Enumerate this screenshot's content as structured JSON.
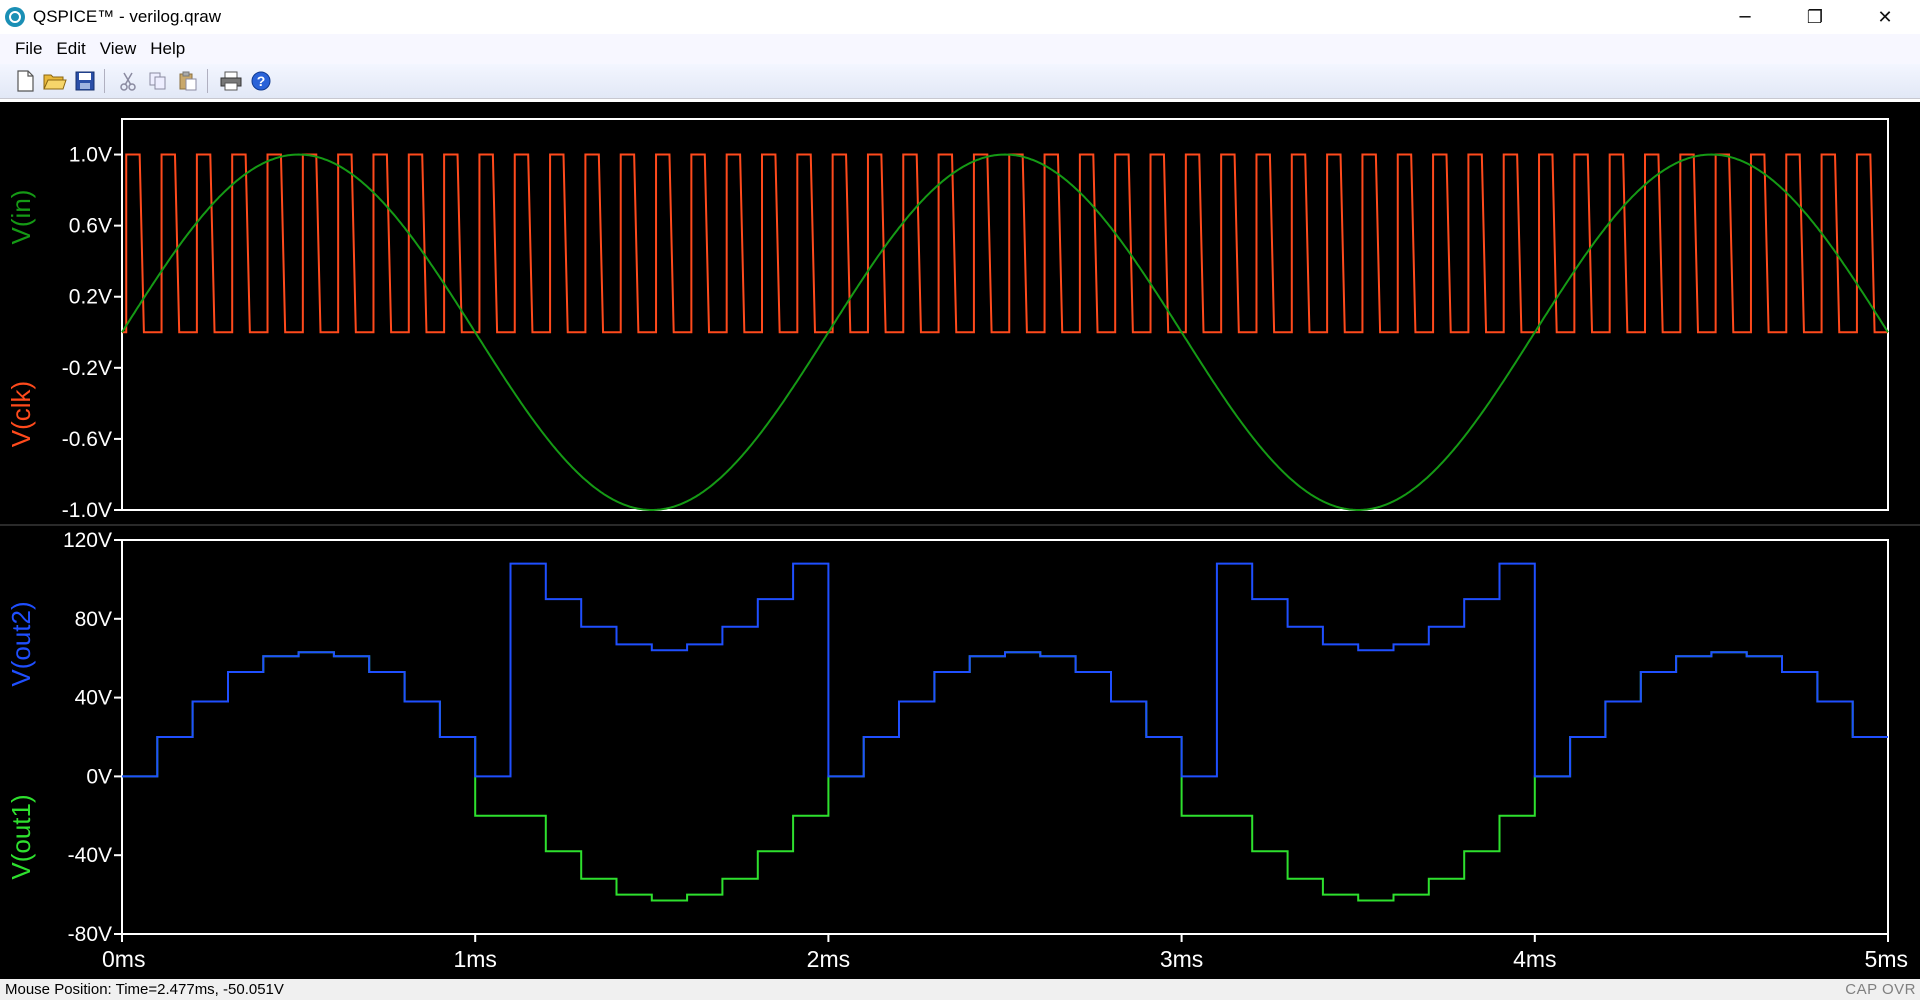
{
  "window": {
    "title": "QSPICE™ - verilog.qraw",
    "minimize_glyph": "─",
    "restore_glyph": "❐",
    "close_glyph": "✕"
  },
  "menu": {
    "items": [
      "File",
      "Edit",
      "View",
      "Help"
    ]
  },
  "toolbar": {
    "buttons": [
      "new-file-icon",
      "open-folder-icon",
      "save-icon",
      "cut-icon",
      "copy-icon",
      "paste-icon",
      "print-icon",
      "help-icon"
    ]
  },
  "colors": {
    "clk": "#ff4a1c",
    "in": "#159a15",
    "out1": "#2ee02e",
    "out2": "#1f4fff",
    "axis": "#ffffff",
    "background": "#000000"
  },
  "chart_data": [
    {
      "type": "line",
      "series": [
        {
          "name": "V(in)",
          "waveform": "sine",
          "amplitude": 1.0,
          "frequency_hz": 500
        },
        {
          "name": "V(clk)",
          "waveform": "square",
          "low": 0.0,
          "high": 1.0,
          "period_ms": 0.1,
          "high_ms": 0.05
        }
      ],
      "yticks": [
        "1.0V",
        "0.6V",
        "0.2V",
        "-0.2V",
        "-0.6V",
        "-1.0V"
      ],
      "ytick_values": [
        1.0,
        0.6,
        0.2,
        -0.2,
        -0.6,
        -1.0
      ],
      "ylim": [
        -1.0,
        1.2
      ],
      "xlim": [
        0,
        5
      ],
      "ylabels": [
        "V(in)",
        "V(clk)"
      ]
    },
    {
      "type": "line",
      "series": [
        {
          "name": "V(out2)",
          "x_ms": [
            0,
            0.1,
            0.2,
            0.3,
            0.4,
            0.5,
            0.6,
            0.7,
            0.8,
            0.9,
            1.0,
            1.1,
            1.2,
            1.3,
            1.4,
            1.5,
            1.6,
            1.7,
            1.8,
            1.9,
            2.0,
            2.1,
            2.2,
            2.3,
            2.4,
            2.5,
            2.6,
            2.7,
            2.8,
            2.9,
            3.0,
            3.1,
            3.2,
            3.3,
            3.4,
            3.5,
            3.6,
            3.7,
            3.8,
            3.9,
            4.0,
            4.1,
            4.2,
            4.3,
            4.4,
            4.5,
            4.6,
            4.7,
            4.8,
            4.9,
            5.0
          ],
          "values": [
            0,
            20,
            38,
            53,
            61,
            63,
            61,
            53,
            38,
            20,
            0,
            108,
            90,
            76,
            67,
            64,
            67,
            76,
            90,
            108,
            0,
            20,
            38,
            53,
            61,
            63,
            61,
            53,
            38,
            20,
            0,
            108,
            90,
            76,
            67,
            64,
            67,
            76,
            90,
            108,
            0,
            20,
            38,
            53,
            61,
            63,
            61,
            53,
            38,
            20,
            20
          ]
        },
        {
          "name": "V(out1)",
          "x_ms": [
            0,
            0.1,
            0.2,
            0.3,
            0.4,
            0.5,
            0.6,
            0.7,
            0.8,
            0.9,
            1.0,
            1.1,
            1.2,
            1.3,
            1.4,
            1.5,
            1.6,
            1.7,
            1.8,
            1.9,
            2.0,
            2.1,
            2.2,
            2.3,
            2.4,
            2.5,
            2.6,
            2.7,
            2.8,
            2.9,
            3.0,
            3.1,
            3.2,
            3.3,
            3.4,
            3.5,
            3.6,
            3.7,
            3.8,
            3.9,
            4.0,
            4.1,
            4.2,
            4.3,
            4.4,
            4.5,
            4.6,
            4.7,
            4.8,
            4.9,
            5.0
          ],
          "values": [
            0,
            20,
            38,
            53,
            61,
            63,
            61,
            53,
            38,
            20,
            -20,
            -20,
            -38,
            -52,
            -60,
            -63,
            -60,
            -52,
            -38,
            -20,
            0,
            20,
            38,
            53,
            61,
            63,
            61,
            53,
            38,
            20,
            -20,
            -20,
            -38,
            -52,
            -60,
            -63,
            -60,
            -52,
            -38,
            -20,
            0,
            20,
            38,
            53,
            61,
            63,
            61,
            53,
            38,
            20,
            20
          ]
        }
      ],
      "yticks": [
        "120V",
        "80V",
        "40V",
        "0V",
        "-40V",
        "-80V"
      ],
      "ytick_values": [
        120,
        80,
        40,
        0,
        -40,
        -80
      ],
      "ylim": [
        -80,
        120
      ],
      "xlim": [
        0,
        5
      ],
      "ylabels": [
        "V(out2)",
        "V(out1)"
      ]
    }
  ],
  "xticks": [
    "0ms",
    "1ms",
    "2ms",
    "3ms",
    "4ms",
    "5ms"
  ],
  "xtick_values": [
    0,
    1,
    2,
    3,
    4,
    5
  ],
  "status": {
    "mouse_position": "Mouse Position: Time=2.477ms, -50.051V",
    "indicators": "CAP OVR"
  }
}
